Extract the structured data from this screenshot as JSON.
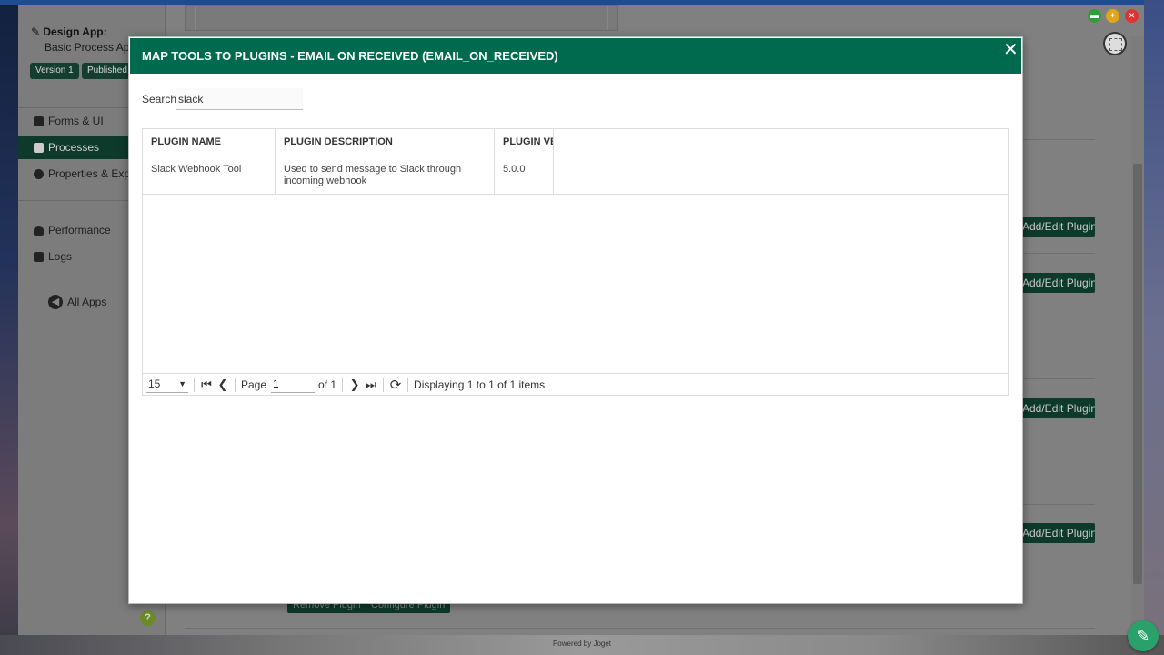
{
  "sidebar": {
    "design_title": "Design App:",
    "app_name": "Basic Process App",
    "version_badge": "Version 1",
    "published_badge": "Published",
    "items": [
      {
        "label": "Forms & UI",
        "icon": "edit-icon"
      },
      {
        "label": "Processes",
        "icon": "grid-icon"
      },
      {
        "label": "Properties & Export",
        "icon": "gear-icon"
      },
      {
        "label": "Performance",
        "icon": "dashboard-icon"
      },
      {
        "label": "Logs",
        "icon": "scroll-icon"
      }
    ],
    "all_apps": "All Apps",
    "help": "?"
  },
  "main": {
    "edit_plugin_label": "Add/Edit Plugin",
    "remove_plugin": "Remove Plugin",
    "configure_plugin": "Configure Plugin",
    "powered_by": "Powered by Joget"
  },
  "modal": {
    "title": "MAP TOOLS TO PLUGINS - EMAIL ON RECEIVED (EMAIL_ON_RECEIVED)",
    "close": "✕",
    "search_label": "Search",
    "search_value": "slack",
    "columns": [
      "PLUGIN NAME",
      "PLUGIN DESCRIPTION",
      "PLUGIN VERSION"
    ],
    "rows": [
      {
        "name": "Slack Webhook Tool",
        "description": "Used to send message to Slack through incoming webhook",
        "version": "5.0.0"
      }
    ],
    "pager": {
      "page_size": "15",
      "page_label": "Page",
      "page_value": "1",
      "of_label": "of 1",
      "status": "Displaying 1 to 1 of 1 items"
    }
  },
  "colors": {
    "modal_header": "#006a4e",
    "sidebar_active": "#0d3a2a",
    "fab": "#2aa06a"
  }
}
